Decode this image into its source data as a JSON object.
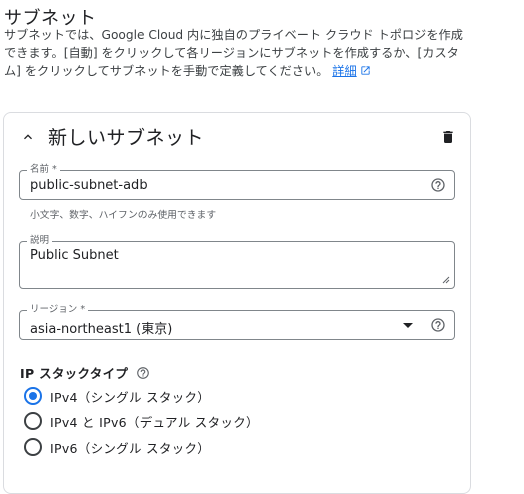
{
  "page": {
    "heading": "サブネット",
    "description": "サブネットでは、Google Cloud 内に独自のプライベート クラウド トポロジを作成できます。[自動] をクリックして各リージョンにサブネットを作成するか、[カスタム] をクリックしてサブネットを手動で定義してください。",
    "learn_more": "詳細"
  },
  "subnet_card": {
    "title": "新しいサブネット",
    "name_field": {
      "label": "名前 *",
      "value": "public-subnet-adb",
      "hint": "小文字、数字、ハイフンのみ使用できます"
    },
    "description_field": {
      "label": "説明",
      "value": "Public Subnet"
    },
    "region_field": {
      "label": "リージョン *",
      "value": "asia-northeast1 (東京)"
    },
    "ip_stack": {
      "title": "IP スタックタイプ",
      "options": [
        {
          "label": "IPv4（シングル スタック）",
          "selected": true
        },
        {
          "label": "IPv4 と IPv6（デュアル スタック）",
          "selected": false
        },
        {
          "label": "IPv6（シングル スタック）",
          "selected": false
        }
      ]
    }
  },
  "colors": {
    "accent": "#1a73e8",
    "text": "#202124",
    "border": "#80868b"
  }
}
